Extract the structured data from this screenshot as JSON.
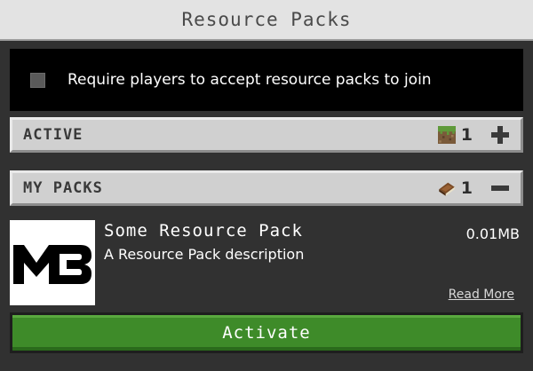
{
  "window": {
    "title": "Resource Packs"
  },
  "require_option": {
    "label": "Require players to accept resource packs to join",
    "checked": false
  },
  "sections": {
    "active": {
      "label": "ACTIVE",
      "count": "1",
      "icon": "grass-block-icon",
      "action": "plus-icon"
    },
    "my_packs": {
      "label": "MY PACKS",
      "count": "1",
      "icon": "book-icon",
      "action": "minus-icon"
    }
  },
  "pack": {
    "name": "Some Resource Pack",
    "description": "A Resource Pack description",
    "size": "0.01MB",
    "logo_text": "M3",
    "read_more": "Read More"
  },
  "activate_button": {
    "label": "Activate"
  },
  "colors": {
    "accent_green": "#3e8b29",
    "panel_bg": "#313131",
    "header_bg": "#d0d0d0"
  }
}
